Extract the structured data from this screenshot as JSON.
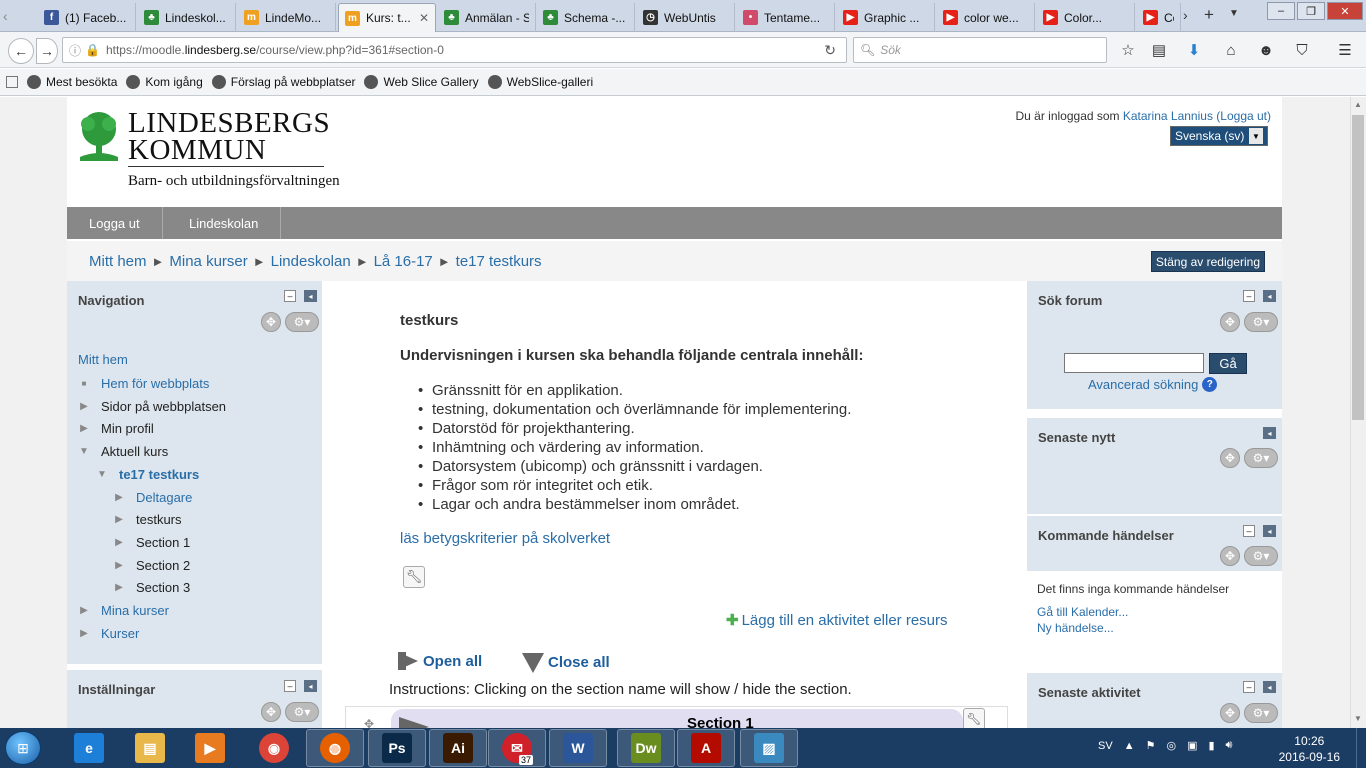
{
  "browser": {
    "tabs": [
      {
        "label": "(1) Faceb...",
        "fav": "facebook-icon",
        "color": "#3b5998",
        "glyph": "f"
      },
      {
        "label": "Lindeskol...",
        "fav": "moodle-tree-icon",
        "color": "#2e8b3a",
        "glyph": "♣"
      },
      {
        "label": "LindeMo...",
        "fav": "moodle-icon",
        "color": "#f0a020",
        "glyph": "m"
      },
      {
        "label": "Kurs: t...",
        "fav": "moodle-icon",
        "color": "#f0a020",
        "glyph": "m"
      },
      {
        "label": "Anmälan - Sit...",
        "fav": "moodle-tree-icon",
        "color": "#2e8b3a",
        "glyph": "♣"
      },
      {
        "label": "Schema -...",
        "fav": "moodle-tree-icon",
        "color": "#2e8b3a",
        "glyph": "♣"
      },
      {
        "label": "WebUntis",
        "fav": "clock-icon",
        "color": "#333333",
        "glyph": "◷"
      },
      {
        "label": "Tentame...",
        "fav": "page-icon",
        "color": "#d04a6a",
        "glyph": "•"
      },
      {
        "label": "Graphic ...",
        "fav": "youtube-icon",
        "color": "#e62117",
        "glyph": "▶"
      },
      {
        "label": "color we...",
        "fav": "youtube-icon",
        "color": "#e62117",
        "glyph": "▶"
      },
      {
        "label": "Color...",
        "fav": "youtube-icon",
        "color": "#e62117",
        "glyph": "▶"
      },
      {
        "label": "Co",
        "fav": "youtube-icon",
        "color": "#e62117",
        "glyph": "▶"
      }
    ],
    "active_tab": 3,
    "url": "https://moodle.",
    "url_domain": "lindesberg.se",
    "url_path": "/course/view.php?id=361#section-0",
    "search_placeholder": "Sök",
    "bookmarks": [
      "Mest besökta",
      "Kom igång",
      "Förslag på webbplatser",
      "Web Slice Gallery",
      "WebSlice-galleri"
    ]
  },
  "header": {
    "org_line1": "LINDESBERGS",
    "org_line2": "KOMMUN",
    "org_sub": "Barn- och utbildningsförvaltningen",
    "login_prefix": "Du är inloggad som ",
    "user_name": "Katarina Lannius",
    "logout": "(Logga ut)",
    "language": "Svenska (sv)"
  },
  "menu": [
    "Logga ut",
    "Lindeskolan"
  ],
  "breadcrumb": [
    "Mitt hem",
    "Mina kurser",
    "Lindeskolan",
    "Lå 16-17",
    "te17 testkurs"
  ],
  "breadcrumb_sep": "►",
  "edit_button": "Stäng av redigering",
  "navigation": {
    "title": "Navigation",
    "home": "Mitt hem",
    "items": [
      {
        "label": "Hem för webbplats",
        "marker": "■",
        "link": true,
        "bold": false
      },
      {
        "label": "Sidor på webbplatsen",
        "marker": "▶",
        "link": false,
        "bold": false
      },
      {
        "label": "Min profil",
        "marker": "▶",
        "link": false,
        "bold": false
      },
      {
        "label": "Aktuell kurs",
        "marker": "▼",
        "link": false,
        "bold": false
      },
      {
        "label": "te17 testkurs",
        "marker": "▼",
        "link": true,
        "bold": true
      },
      {
        "label": "Deltagare",
        "marker": "▶",
        "link": true,
        "bold": false
      },
      {
        "label": "testkurs",
        "marker": "▶",
        "link": false,
        "bold": false
      },
      {
        "label": "Section 1",
        "marker": "▶",
        "link": false,
        "bold": false
      },
      {
        "label": "Section 2",
        "marker": "▶",
        "link": false,
        "bold": false
      },
      {
        "label": "Section 3",
        "marker": "▶",
        "link": false,
        "bold": false
      },
      {
        "label": "Mina kurser",
        "marker": "▶",
        "link": true,
        "bold": false
      },
      {
        "label": "Kurser",
        "marker": "▶",
        "link": true,
        "bold": false
      }
    ]
  },
  "settings_block": {
    "title": "Inställningar"
  },
  "main": {
    "title": "testkurs",
    "heading": "Undervisningen i kursen ska behandla följande centrala innehåll:",
    "items": [
      "Gränssnitt för en applikation.",
      "testning, dokumentation och överlämnande för implementering.",
      "Datorstöd för projekthantering.",
      "Inhämtning och värdering av information.",
      "Datorsystem (ubicomp) och gränssnitt i vardagen.",
      "Frågor som rör integritet och etik.",
      "Lagar och andra bestämmelser inom området."
    ],
    "grade_link": "läs betygskriterier på skolverket",
    "add_activity": "Lägg till en aktivitet eller resurs",
    "open_all": "Open all",
    "close_all": "Close all",
    "instructions": "Instructions: Clicking on the section name will show / hide the section.",
    "section_title": "Section 1"
  },
  "search_forum": {
    "title": "Sök forum",
    "go": "Gå",
    "advanced": "Avancerad sökning"
  },
  "latest_news": {
    "title": "Senaste nytt"
  },
  "upcoming": {
    "title": "Kommande händelser",
    "empty": "Det finns inga kommande händelser",
    "calendar_link": "Gå till Kalender...",
    "new_event": "Ny händelse..."
  },
  "recent_activity": {
    "title": "Senaste aktivitet"
  },
  "taskbar": {
    "apps": [
      {
        "name": "internet-explorer-icon",
        "glyph": "e",
        "color": "#1e7fd8"
      },
      {
        "name": "file-explorer-icon",
        "glyph": "▤",
        "color": "#e8b84a"
      },
      {
        "name": "media-player-icon",
        "glyph": "▶",
        "color": "#e87a20"
      },
      {
        "name": "chrome-icon",
        "glyph": "◉",
        "color": "#db4437"
      },
      {
        "name": "firefox-icon",
        "glyph": "◍",
        "color": "#e66000"
      },
      {
        "name": "photoshop-icon",
        "glyph": "Ps",
        "color": "#0b2a4a"
      },
      {
        "name": "illustrator-icon",
        "glyph": "Ai",
        "color": "#3a1a00"
      },
      {
        "name": "mail-icon",
        "glyph": "✉",
        "color": "#d0202a"
      },
      {
        "name": "word-icon",
        "glyph": "W",
        "color": "#2b579a"
      },
      {
        "name": "dreamweaver-icon",
        "glyph": "Dw",
        "color": "#6a8d1f"
      },
      {
        "name": "acrobat-icon",
        "glyph": "A",
        "color": "#b30b00"
      },
      {
        "name": "picture-viewer-icon",
        "glyph": "▨",
        "color": "#3a8ac0"
      }
    ],
    "mail_badge": "37",
    "lang": "SV",
    "time": "10:26",
    "date": "2016-09-16"
  }
}
